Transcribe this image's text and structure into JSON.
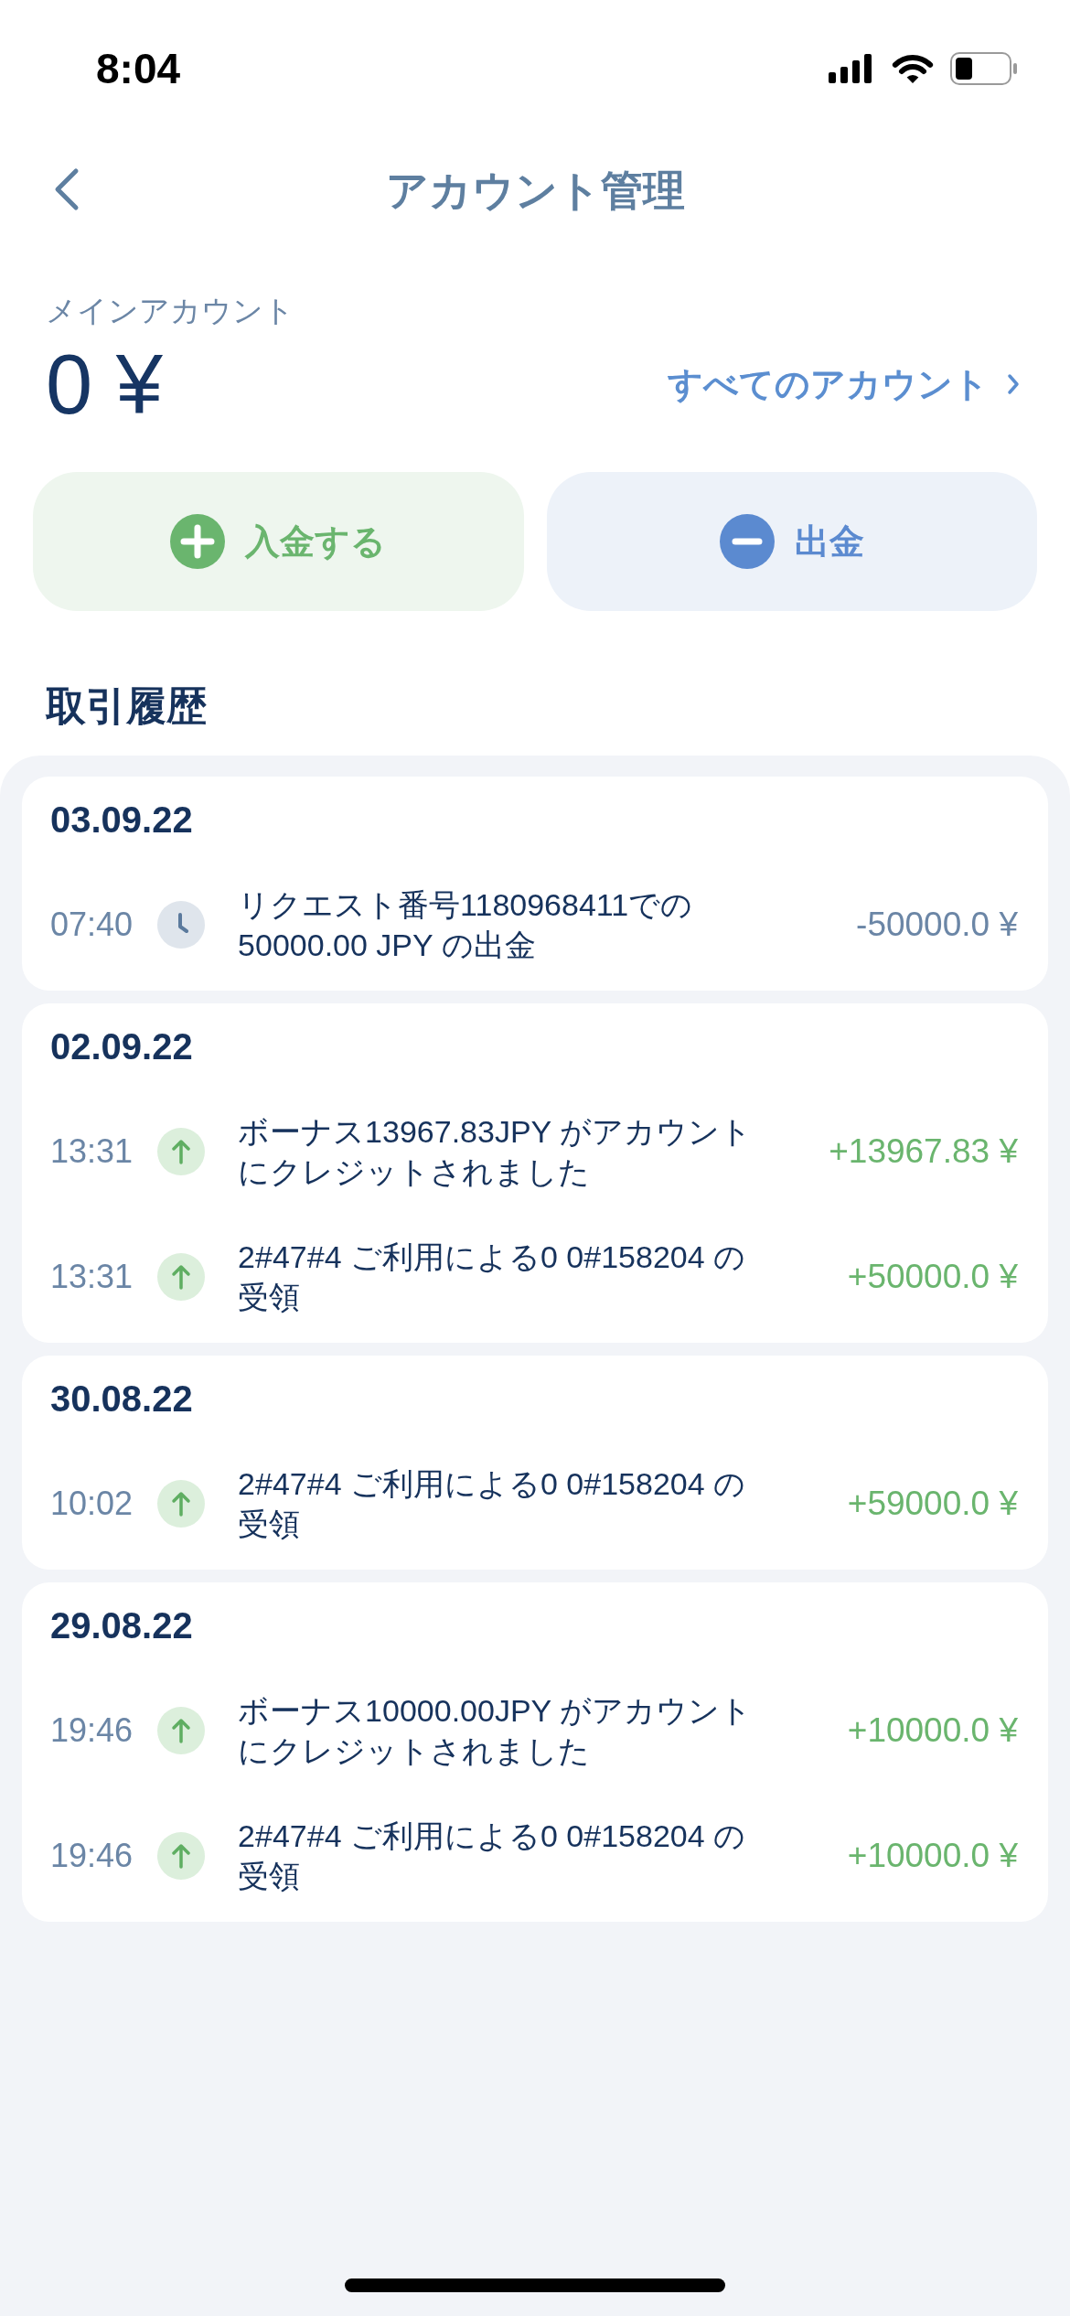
{
  "status_bar": {
    "time": "8:04"
  },
  "header": {
    "title": "アカウント管理"
  },
  "account": {
    "label": "メインアカウント",
    "balance": "0 ¥",
    "all_accounts_link": "すべてのアカウント"
  },
  "actions": [
    {
      "kind": "deposit",
      "label": "入金する"
    },
    {
      "kind": "withdraw",
      "label": "出金"
    }
  ],
  "history": {
    "title": "取引履歴",
    "groups": [
      {
        "date": "03.09.22",
        "transactions": [
          {
            "kind": "pending",
            "time": "07:40",
            "description": "リクエスト番号1180968411での50000.00 JPY の出金",
            "amount": "-50000.0 ¥"
          }
        ]
      },
      {
        "date": "02.09.22",
        "transactions": [
          {
            "kind": "credit",
            "time": "13:31",
            "description": "ボーナス13967.83JPY がアカウントにクレジットされました",
            "amount": "+13967.83 ¥"
          },
          {
            "kind": "credit",
            "time": "13:31",
            "description": "2#47#4 ご利用による0 0#158204 の受領",
            "amount": "+50000.0 ¥"
          }
        ]
      },
      {
        "date": "30.08.22",
        "transactions": [
          {
            "kind": "credit",
            "time": "10:02",
            "description": "2#47#4 ご利用による0 0#158204 の受領",
            "amount": "+59000.0 ¥"
          }
        ]
      },
      {
        "date": "29.08.22",
        "transactions": [
          {
            "kind": "credit",
            "time": "19:46",
            "description": "ボーナス10000.00JPY がアカウントにクレジットされました",
            "amount": "+10000.0 ¥"
          },
          {
            "kind": "credit",
            "time": "19:46",
            "description": "2#47#4 ご利用による0 0#158204 の受領",
            "amount": "+10000.0 ¥"
          }
        ]
      }
    ]
  }
}
